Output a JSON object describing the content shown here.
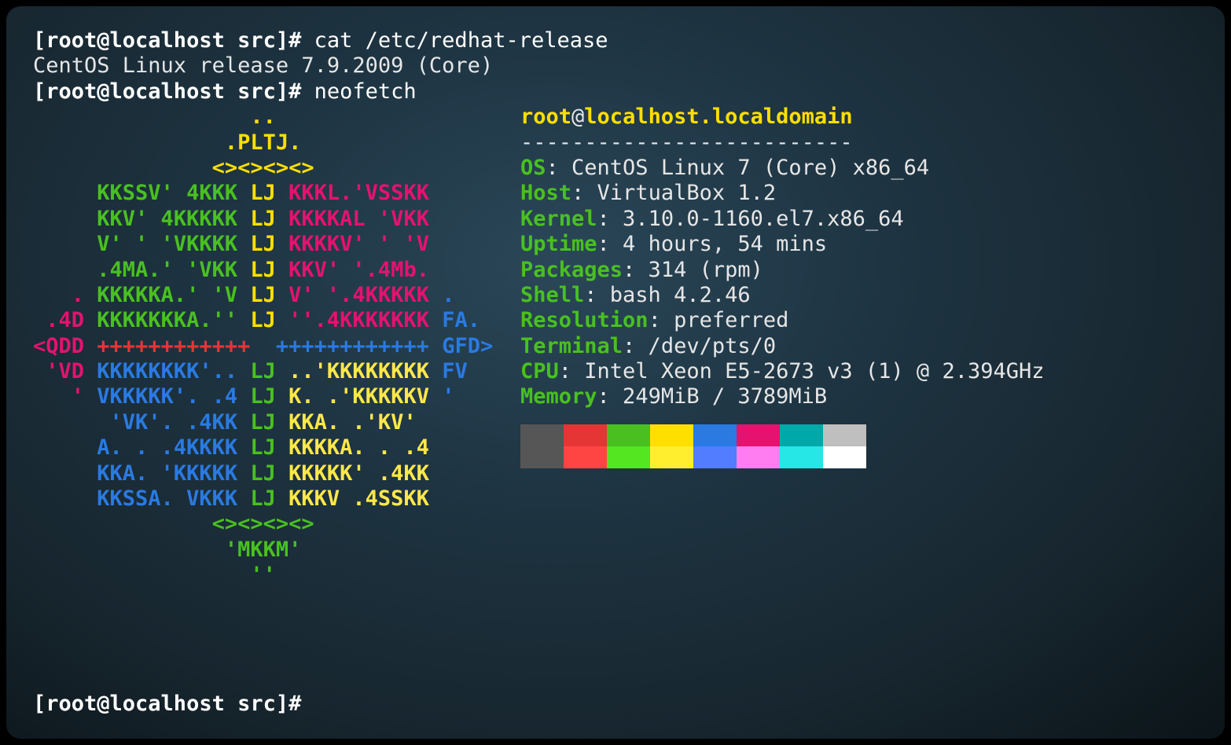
{
  "prompt1": "[root@localhost src]# ",
  "cmd1": "cat /etc/redhat-release",
  "out1": "CentOS Linux release 7.9.2009 (Core)",
  "prompt2": "[root@localhost src]# ",
  "cmd2": "neofetch",
  "prompt3": "[root@localhost src]# ",
  "logo": {
    "l01": {
      "pad": "                 ",
      "a": "..",
      "b": "",
      "c": "",
      "d": ""
    },
    "l02": {
      "pad": "               ",
      "a": ".PLTJ.",
      "b": "",
      "c": "",
      "d": ""
    },
    "l03": {
      "pad": "              ",
      "a": "<><><><>",
      "b": "",
      "c": "",
      "d": ""
    },
    "l04": {
      "pad": "     ",
      "a": "KKSSV' 4KKK ",
      "b": "LJ ",
      "c": "KKKL.'VSSKK",
      "d": ""
    },
    "l05": {
      "pad": "     ",
      "a": "KKV' 4KKKKK ",
      "b": "LJ ",
      "c": "KKKKAL 'VKK",
      "d": ""
    },
    "l06": {
      "pad": "     ",
      "a": "V' ' 'VKKKK ",
      "b": "LJ ",
      "c": "KKKKV' ' 'V",
      "d": ""
    },
    "l07": {
      "pad": "     ",
      "a": ".4MA.' 'VKK ",
      "b": "LJ ",
      "c": "KKV' '.4Mb.",
      "d": ""
    },
    "l08": {
      "pad": "   ",
      "a": ". ",
      "b": "KKKKKA.' 'V ",
      "c": "LJ ",
      "d": "V' '.4KKKKK ",
      "e": "."
    },
    "l09": {
      "pad": " ",
      "a": ".4D ",
      "b": "KKKKKKKA.'' ",
      "c": "LJ ",
      "d": "''.4KKKKKKK ",
      "e": "FA."
    },
    "l10": {
      "pad": "",
      "a": "<QDD ",
      "b": "++++++++++++  ",
      "c": "++++++++++++ ",
      "d": "GFD>"
    },
    "l11": {
      "pad": " ",
      "a": "'VD ",
      "b": "KKKKKKKK'.. ",
      "c": "LJ ",
      "d": "..'KKKKKKKK ",
      "e": "FV"
    },
    "l12": {
      "pad": "   ",
      "a": "' ",
      "b": "VKKKKK'. .4 ",
      "c": "LJ ",
      "d": "K. .'KKKKKV ",
      "e": "'"
    },
    "l13": {
      "pad": "      ",
      "a": "'VK'. .4KK ",
      "b": "LJ ",
      "c": "KKA. .'KV'",
      "d": ""
    },
    "l14": {
      "pad": "     ",
      "a": "A. . .4KKKK ",
      "b": "LJ ",
      "c": "KKKKA. . .4",
      "d": ""
    },
    "l15": {
      "pad": "     ",
      "a": "KKA. 'KKKKK ",
      "b": "LJ ",
      "c": "KKKKK' .4KK",
      "d": ""
    },
    "l16": {
      "pad": "     ",
      "a": "KKSSA. VKKK ",
      "b": "LJ ",
      "c": "KKKV .4SSKK",
      "d": ""
    },
    "l17": {
      "pad": "              ",
      "a": "<><><><>",
      "b": "",
      "c": "",
      "d": ""
    },
    "l18": {
      "pad": "               ",
      "a": "'MKKM'",
      "b": "",
      "c": "",
      "d": ""
    },
    "l19": {
      "pad": "                 ",
      "a": "''",
      "b": "",
      "c": "",
      "d": ""
    }
  },
  "info": {
    "user": "root",
    "at": "@",
    "host": "localhost.localdomain",
    "sep": "--------------------------",
    "rows": [
      {
        "k": "OS",
        "v": ": CentOS Linux 7 (Core) x86_64"
      },
      {
        "k": "Host",
        "v": ": VirtualBox 1.2"
      },
      {
        "k": "Kernel",
        "v": ": 3.10.0-1160.el7.x86_64"
      },
      {
        "k": "Uptime",
        "v": ": 4 hours, 54 mins"
      },
      {
        "k": "Packages",
        "v": ": 314 (rpm)"
      },
      {
        "k": "Shell",
        "v": ": bash 4.2.46"
      },
      {
        "k": "Resolution",
        "v": ": preferred"
      },
      {
        "k": "Terminal",
        "v": ": /dev/pts/0"
      },
      {
        "k": "CPU",
        "v": ": Intel Xeon E5-2673 v3 (1) @ 2.394GHz"
      },
      {
        "k": "Memory",
        "v": ": 249MiB / 3789MiB"
      }
    ]
  }
}
